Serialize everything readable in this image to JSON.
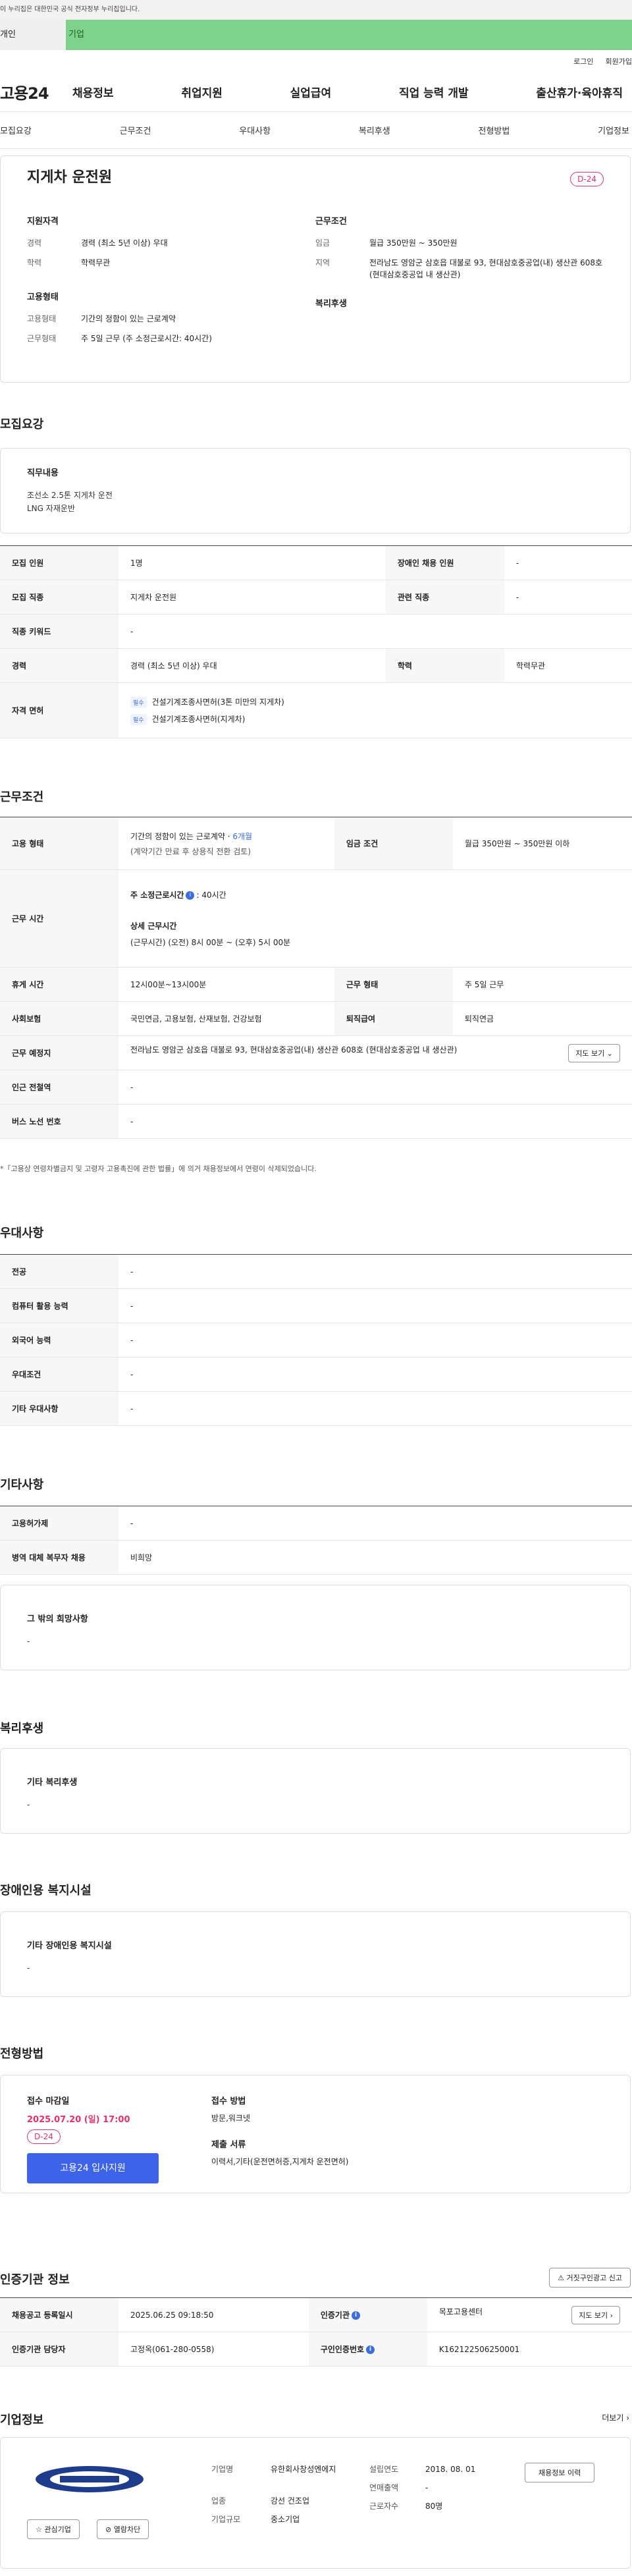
{
  "gov_banner": "이 누리집은 대한민국 공식 전자정부 누리집입니다.",
  "tabs": {
    "individual": "개인",
    "company": "기업"
  },
  "util": {
    "login": "로그인",
    "join": "회원가입"
  },
  "logo": "고용24",
  "gnb": [
    "채용정보",
    "취업지원",
    "실업급여",
    "직업 능력 개발",
    "출산휴가·육아휴직"
  ],
  "anchor": [
    "모집요강",
    "근무조건",
    "우대사항",
    "복리후생",
    "전형방법",
    "기업정보"
  ],
  "summary": {
    "title": "지게차 운전원",
    "dday": "D-24",
    "qual_title": "지원자격",
    "career_label": "경력",
    "career": "경력 (최소 5년 이상) 우대",
    "edu_label": "학력",
    "edu": "학력무관",
    "employ_title": "고용형태",
    "emp_label": "고용형태",
    "emp": "기간의 정함이 있는 근로계약",
    "work_label": "근무형태",
    "work": "주 5일 근무 (주 소정근로시간: 40시간)",
    "cond_title": "근무조건",
    "wage_label": "임금",
    "wage": "월급 350만원 ~ 350만원",
    "region_label": "지역",
    "region": "전라남도 영암군 삼호읍 대불로 93, 현대삼호중공업(내) 생산관 608호 (현대삼호중공업 내 생산관)",
    "welfare_title": "복리후생"
  },
  "recruit": {
    "title": "모집요강",
    "duty_title": "직무내용",
    "duty1": "조선소 2.5톤 지게차 운전",
    "duty2": "LNG 자재운반",
    "rows": {
      "count_l": "모집 인원",
      "count": "1명",
      "dis_l": "장애인 채용 인원",
      "dis": "-",
      "job_l": "모집 직종",
      "job": "지게차 운전원",
      "rel_l": "관련 직종",
      "rel": "-",
      "kw_l": "직종 키워드",
      "kw": "-",
      "car_l": "경력",
      "car": "경력 (최소 5년 이상) 우대",
      "edu_l": "학력",
      "edu": "학력무관",
      "lic_l": "자격 면허",
      "must": "필수",
      "lic1": "건설기계조종사면허(3톤 미만의 지게차)",
      "lic2": "건설기계조종사면허(지게차)"
    }
  },
  "work": {
    "title": "근무조건",
    "type_l": "고용 형태",
    "type1": "기간의 정함이 있는 근로계약 · ",
    "type_m": "6개월",
    "type2": "(계약기간 만료 후 상용직 전환 검토)",
    "wage_l": "임금 조건",
    "wage": "월급 350만원 ~ 350만원 이하",
    "time_l": "근무 시간",
    "week_title": "주 소정근로시간",
    "week_val": ": 40시간",
    "detail_title": "상세 근무시간",
    "detail": "(근무시간) (오전) 8시 00분 ~ (오후) 5시 00분",
    "rest_l": "휴게 시간",
    "rest": "12시00분~13시00분",
    "form_l": "근무 형태",
    "form": "주 5일 근무",
    "ins_l": "사회보험",
    "ins": "국민연금, 고용보험, 산재보험, 건강보험",
    "ret_l": "퇴직급여",
    "ret": "퇴직연금",
    "place_l": "근무 예정지",
    "place": "전라남도 영암군 삼호읍 대불로 93, 현대삼호중공업(내) 생산관 608호 (현대삼호중공업 내 생산관)",
    "map": "지도 보기",
    "sub_l": "인근 전철역",
    "sub": "-",
    "bus_l": "버스 노선 번호",
    "bus": "-",
    "note": "*「고용상 연령차별금지 및 고령자 고용촉진에 관한 법률」에 의거 채용정보에서 연령이 삭제되었습니다."
  },
  "pref": {
    "title": "우대사항",
    "r1l": "전공",
    "r1": "-",
    "r2l": "컴퓨터 활용 능력",
    "r2": "-",
    "r3l": "외국어 능력",
    "r3": "-",
    "r4l": "우대조건",
    "r4": "-",
    "r5l": "기타 우대사항",
    "r5": "-"
  },
  "etc": {
    "title": "기타사항",
    "r1l": "고용허가제",
    "r1": "-",
    "r2l": "병역 대체 복무자 채용",
    "r2": "비희망",
    "box_title": "그 밖의 희망사항",
    "box": "-"
  },
  "welfare": {
    "title": "복리후생",
    "box_title": "기타 복리후생",
    "box": "-"
  },
  "disab": {
    "title": "장애인용 복지시설",
    "box_title": "기타 장애인용 복지시설",
    "box": "-"
  },
  "apply": {
    "title": "전형방법",
    "deadline_title": "접수 마감일",
    "deadline": "2025.07.20 (일) 17:00",
    "dday": "D-24",
    "btn": "고용24 입사지원",
    "method_title": "접수 방법",
    "method": "방문,워크넷",
    "doc_title": "제출 서류",
    "doc": "이력서,기타(운전면허증,지게차 운전면허)"
  },
  "cert": {
    "title": "인증기관 정보",
    "report": "거짓구인광고 신고",
    "reg_l": "채용공고 등록일시",
    "reg": "2025.06.25 09:18:50",
    "org_l": "인증기관",
    "org": "목포고용센터",
    "map": "지도 보기",
    "mgr_l": "인증기관 담당자",
    "mgr": "고정옥(061-280-0558)",
    "no_l": "구인인증번호",
    "no": "K162122506250001"
  },
  "company": {
    "title": "기업정보",
    "more": "더보기",
    "name_l": "기업명",
    "name": "유한회사창성엔에지",
    "ind_l": "업종",
    "ind": "강선 건조업",
    "size_l": "기업규모",
    "size": "중소기업",
    "est_l": "설립연도",
    "est": "2018. 08. 01",
    "sales_l": "연매출액",
    "sales": "-",
    "emp_l": "근로자수",
    "emp": "80명",
    "fav": "관심기업",
    "block": "열람차단",
    "btn": "채용정보 이력"
  }
}
